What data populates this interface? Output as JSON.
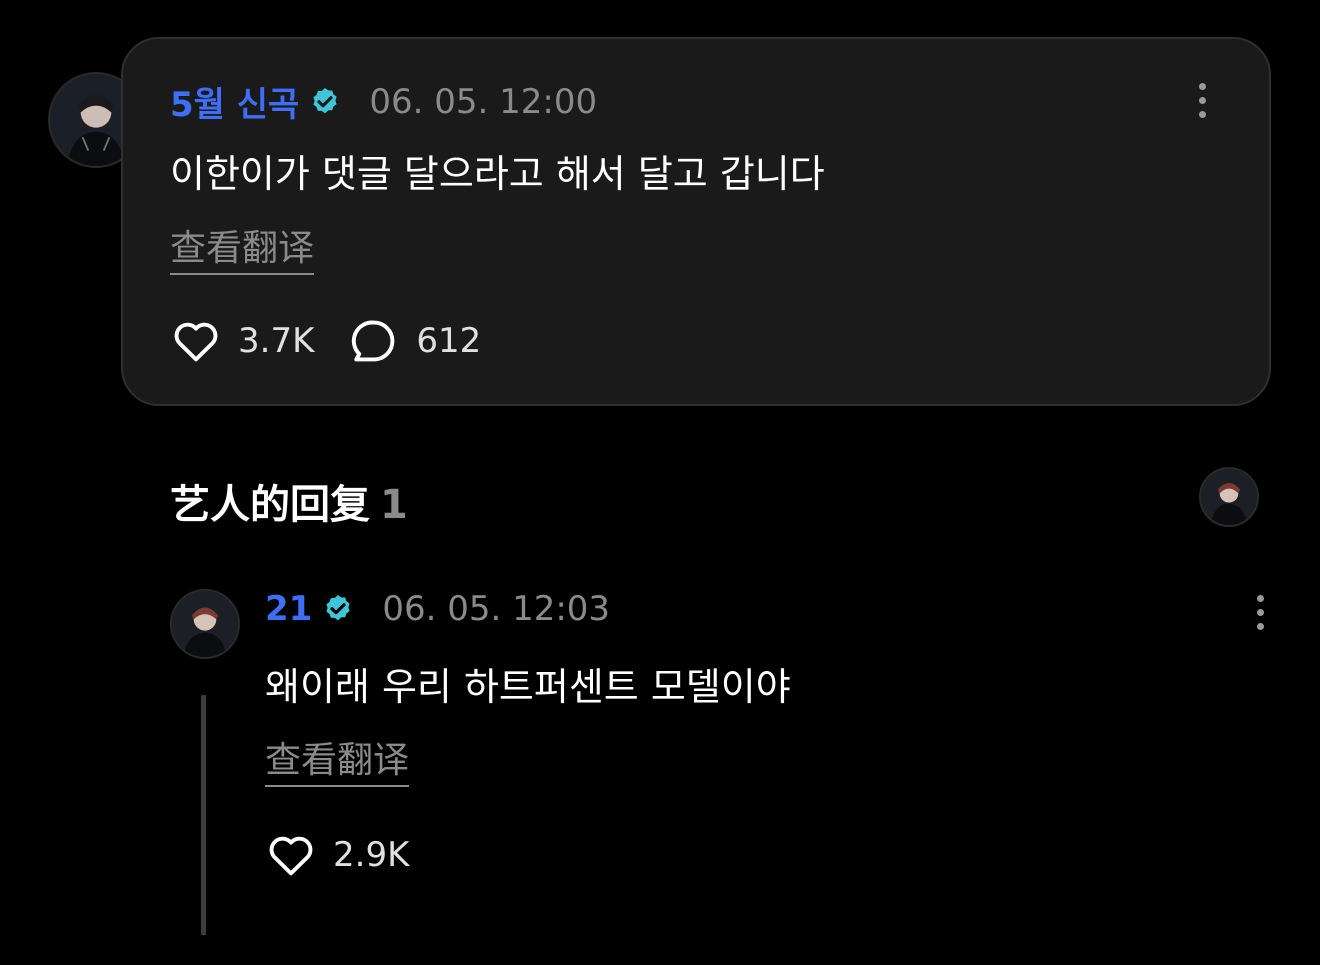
{
  "main_comment": {
    "author": "5월 신곡",
    "timestamp": "06. 05. 12:00",
    "text": "이한이가 댓글 달으라고 해서 달고 갑니다",
    "translate_label": "查看翻译",
    "likes": "3.7K",
    "replies": "612"
  },
  "artist_replies": {
    "title": "艺人的回复",
    "count": "1"
  },
  "reply": {
    "author": "21",
    "timestamp": "06. 05. 12:03",
    "text": "왜이래 우리 하트퍼센트 모델이야",
    "translate_label": "查看翻译",
    "likes": "2.9K"
  },
  "colors": {
    "author_name": "#3d6ef5",
    "verified_badge": "#3ec6d8",
    "card_background": "#1a1a1a",
    "muted_text": "#8a8a8a"
  },
  "icons": [
    "verified-icon",
    "more-options-icon",
    "heart-icon",
    "comment-bubble-icon",
    "avatar"
  ]
}
